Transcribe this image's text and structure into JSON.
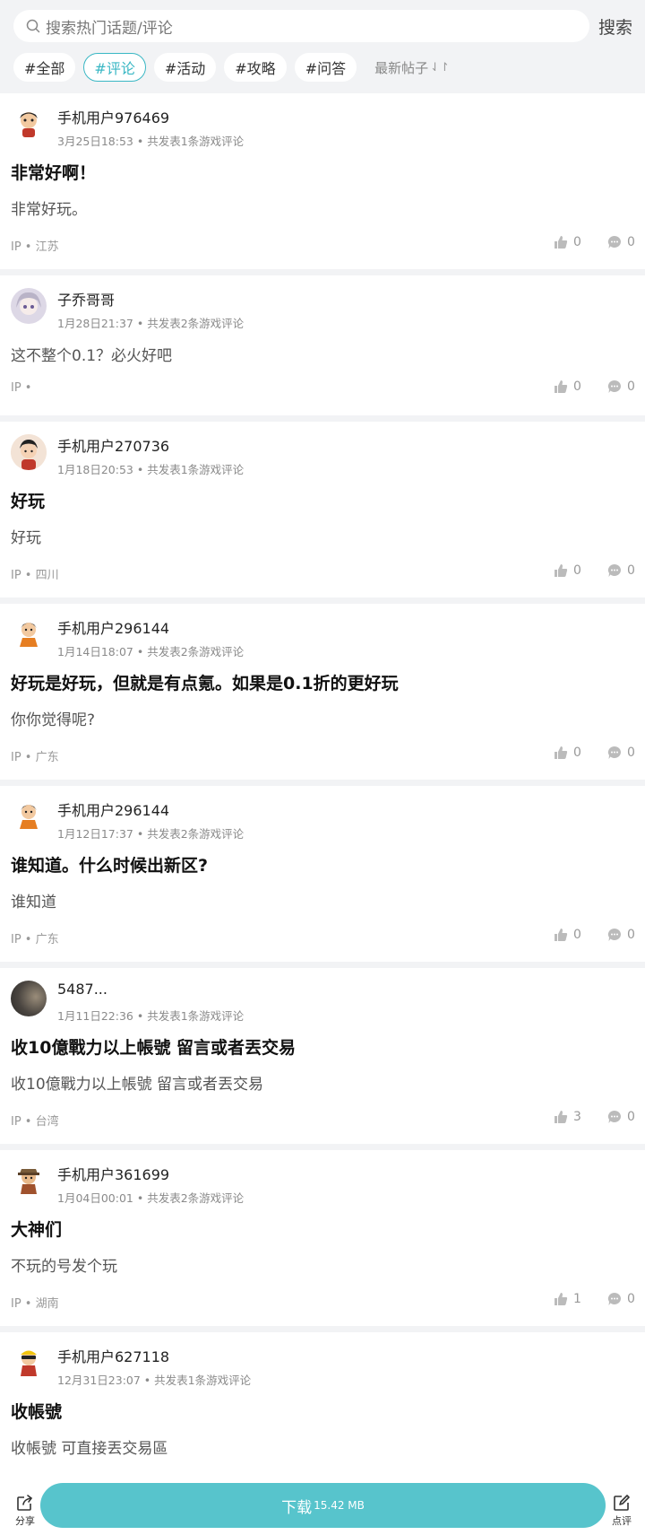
{
  "search": {
    "placeholder": "搜索热门话题/评论",
    "button": "搜索"
  },
  "tags": [
    "#全部",
    "#评论",
    "#活动",
    "#攻略",
    "#问答"
  ],
  "active_tag_index": 1,
  "sort": {
    "label": "最新帖子",
    "icon": "sort-arrows-icon"
  },
  "posts": [
    {
      "user": "手机用户976469",
      "meta": "3月25日18:53 • 共发表1条游戏评论",
      "title": "非常好啊！",
      "body": "非常好玩。",
      "ip": "IP • 江苏",
      "likes": "0",
      "comments": "0"
    },
    {
      "user": "子乔哥哥",
      "meta": "1月28日21:37 • 共发表2条游戏评论",
      "title": "",
      "body": "这不整个0.1？必火好吧",
      "ip": "IP •",
      "likes": "0",
      "comments": "0"
    },
    {
      "user": "手机用户270736",
      "meta": "1月18日20:53 • 共发表1条游戏评论",
      "title": "好玩",
      "body": "好玩",
      "ip": "IP • 四川",
      "likes": "0",
      "comments": "0"
    },
    {
      "user": "手机用户296144",
      "meta": "1月14日18:07 • 共发表2条游戏评论",
      "title": "好玩是好玩，但就是有点氪。如果是0.1折的更好玩",
      "body": "你你觉得呢?",
      "ip": "IP • 广东",
      "likes": "0",
      "comments": "0"
    },
    {
      "user": "手机用户296144",
      "meta": "1月12日17:37 • 共发表2条游戏评论",
      "title": "谁知道。什么时候出新区?",
      "body": "谁知道",
      "ip": "IP • 广东",
      "likes": "0",
      "comments": "0"
    },
    {
      "user": "5487...",
      "meta": "1月11日22:36 • 共发表1条游戏评论",
      "title": "收10億戰力以上帳號 留言或者丟交易",
      "body": "收10億戰力以上帳號 留言或者丟交易",
      "ip": "IP • 台湾",
      "likes": "3",
      "comments": "0"
    },
    {
      "user": "手机用户361699",
      "meta": "1月04日00:01 • 共发表2条游戏评论",
      "title": "大神们",
      "body": "不玩的号发个玩",
      "ip": "IP • 湖南",
      "likes": "1",
      "comments": "0"
    },
    {
      "user": "手机用户627118",
      "meta": "12月31日23:07 • 共发表1条游戏评论",
      "title": "收帳號",
      "body": "收帳號 可直接丟交易區",
      "ip": "",
      "likes": "",
      "comments": ""
    }
  ],
  "bottom": {
    "share": "分享",
    "download": "下载",
    "download_size": "15.42 MB",
    "review": "点评"
  },
  "colors": {
    "accent": "#39b7c4",
    "download_bg": "#57c4cc",
    "page_bg": "#f2f3f5"
  }
}
